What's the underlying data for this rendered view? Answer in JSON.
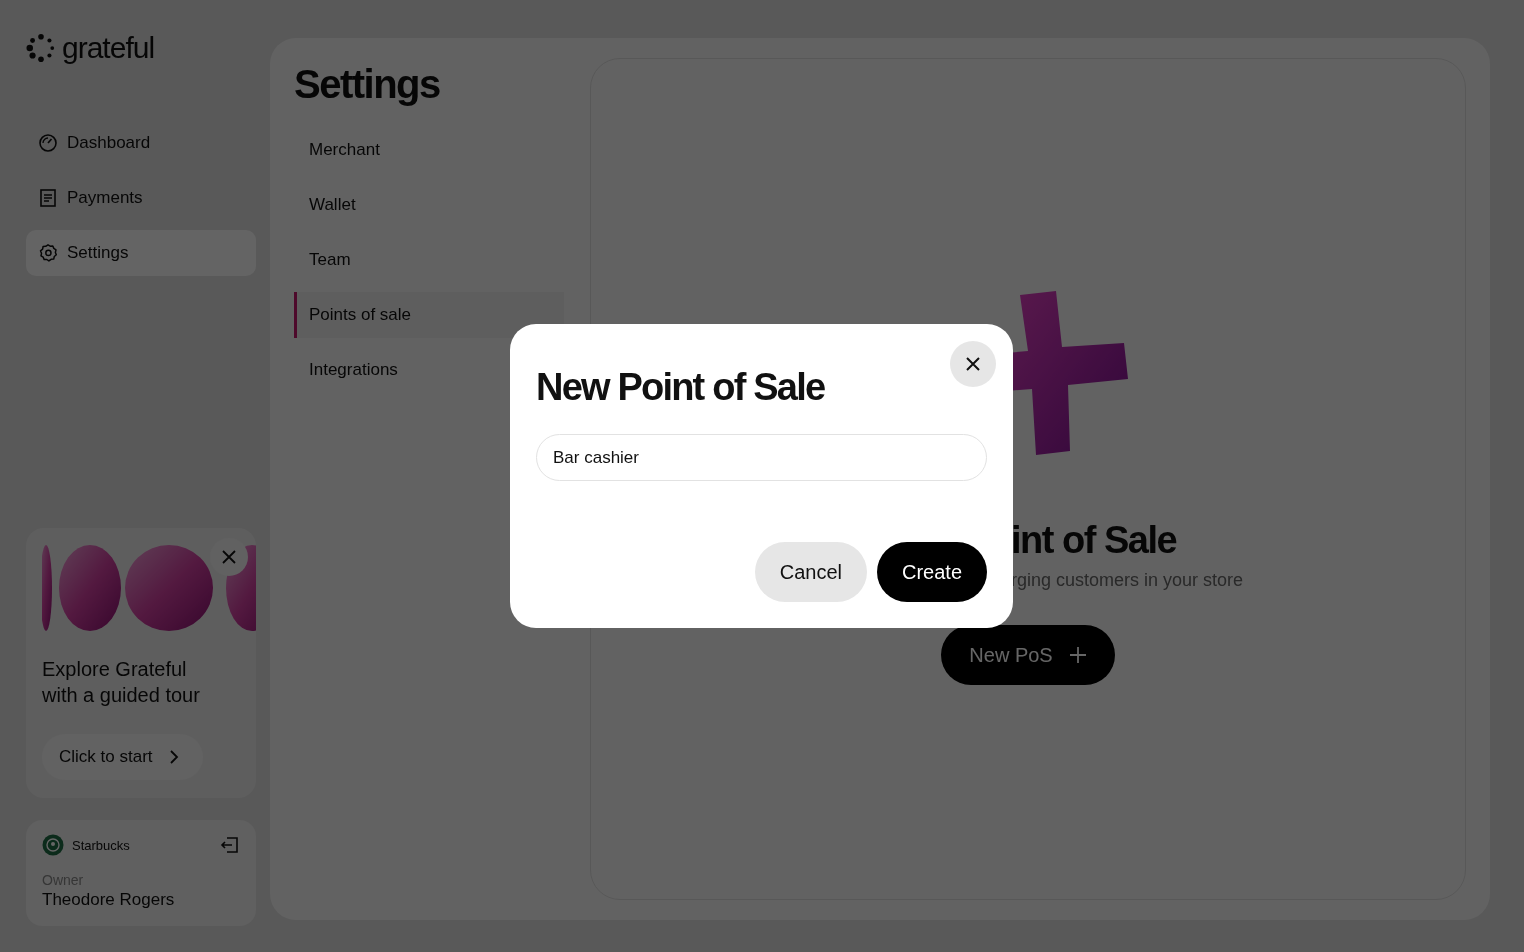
{
  "brand": {
    "name": "grateful"
  },
  "sidebar": {
    "items": [
      {
        "label": "Dashboard",
        "selected": false
      },
      {
        "label": "Payments",
        "selected": false
      },
      {
        "label": "Settings",
        "selected": true
      }
    ]
  },
  "tour_card": {
    "title": "Explore Grateful with a guided tour",
    "button": "Click to start"
  },
  "account": {
    "merchant": "Starbucks",
    "role": "Owner",
    "name": "Theodore Rogers"
  },
  "settings": {
    "title": "Settings",
    "menu": [
      {
        "label": "Merchant",
        "selected": false
      },
      {
        "label": "Wallet",
        "selected": false
      },
      {
        "label": "Team",
        "selected": false
      },
      {
        "label": "Points of sale",
        "selected": true
      },
      {
        "label": "Integrations",
        "selected": false
      }
    ]
  },
  "empty_state": {
    "title": "int of Sale",
    "subtitle": "rging customers in your store",
    "button": "New PoS"
  },
  "dialog": {
    "title": "New Point of Sale",
    "name_field": {
      "value": "Bar cashier"
    },
    "buttons": [
      {
        "label": "Cancel",
        "kind": "secondary"
      },
      {
        "label": "Create",
        "kind": "primary"
      }
    ]
  }
}
